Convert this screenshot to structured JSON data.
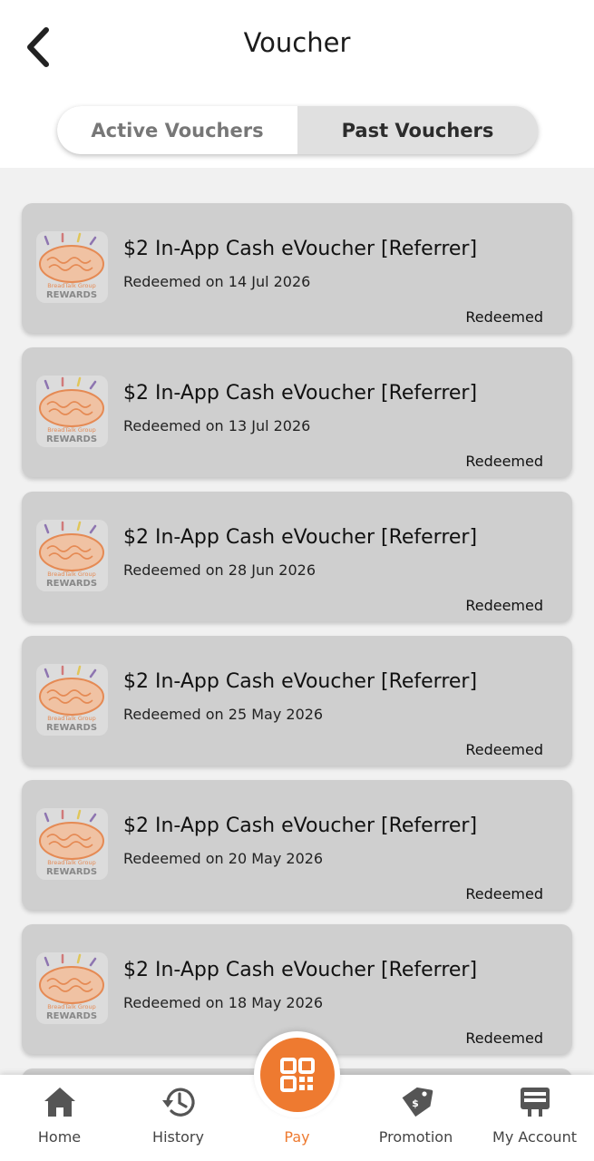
{
  "header": {
    "title": "Voucher",
    "tabs": [
      {
        "label": "Active Vouchers",
        "selected": false
      },
      {
        "label": "Past Vouchers",
        "selected": true
      }
    ]
  },
  "vouchers": [
    {
      "title": "$2 In-App Cash eVoucher [Referrer]",
      "date": "Redeemed on 14 Jul 2026",
      "status": "Redeemed"
    },
    {
      "title": "$2 In-App Cash eVoucher [Referrer]",
      "date": "Redeemed on 13 Jul 2026",
      "status": "Redeemed"
    },
    {
      "title": "$2 In-App Cash eVoucher [Referrer]",
      "date": "Redeemed on 28 Jun 2026",
      "status": "Redeemed"
    },
    {
      "title": "$2 In-App Cash eVoucher [Referrer]",
      "date": "Redeemed on 25 May 2026",
      "status": "Redeemed"
    },
    {
      "title": "$2 In-App Cash eVoucher [Referrer]",
      "date": "Redeemed on 20 May 2026",
      "status": "Redeemed"
    },
    {
      "title": "$2 In-App Cash eVoucher [Referrer]",
      "date": "Redeemed on 18 May 2026",
      "status": "Redeemed"
    }
  ],
  "logo": {
    "brand": "BreadTalk Group",
    "text": "REWARDS"
  },
  "nav": [
    {
      "label": "Home",
      "icon": "home-icon"
    },
    {
      "label": "History",
      "icon": "history-icon"
    },
    {
      "label": "Pay",
      "icon": "qr-code-icon",
      "active": true
    },
    {
      "label": "Promotion",
      "icon": "tag-icon"
    },
    {
      "label": "My Account",
      "icon": "account-icon"
    }
  ],
  "colors": {
    "accent": "#ee7a30",
    "card": "#cfcfcf",
    "background": "#f1f1f1"
  }
}
